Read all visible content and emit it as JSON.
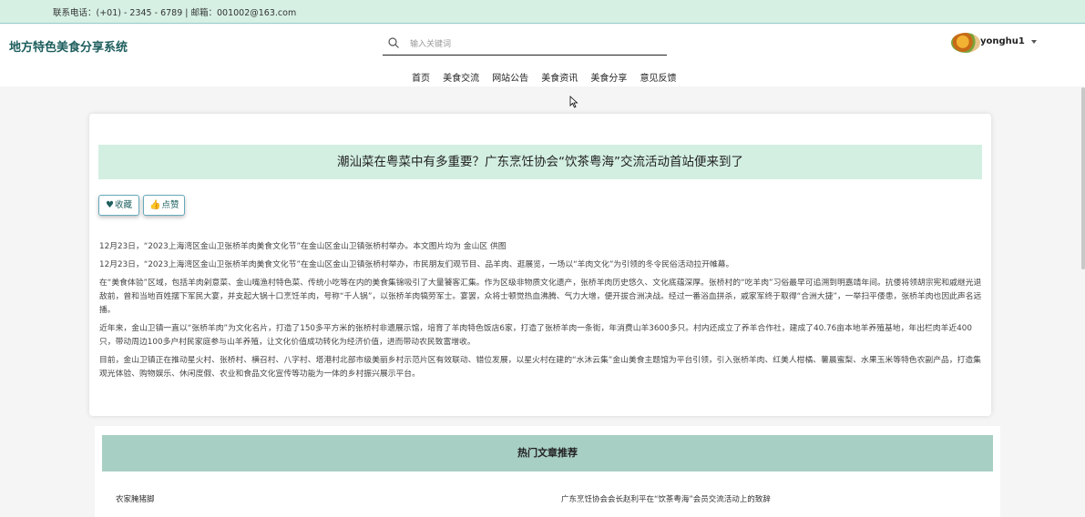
{
  "topbar": {
    "contact": "联系电话：(+01) - 2345 - 6789 | 邮箱：001002@163.com"
  },
  "header": {
    "logo": "地方特色美食分享系统",
    "search_placeholder": "输入关键词",
    "username": "yonghu1"
  },
  "nav": [
    "首页",
    "美食交流",
    "网站公告",
    "美食资讯",
    "美食分享",
    "意见反馈"
  ],
  "article": {
    "title": "潮汕菜在粤菜中有多重要？广东烹饪协会“饮茶粤海”交流活动首站便来到了",
    "favorite_label": "收藏",
    "like_label": "点赞",
    "paragraphs": [
      "12月23日，“2023上海湾区金山卫张桥羊肉美食文化节”在金山区金山卫镇张桥村举办。本文图片均为 金山区 供图",
      "12月23日，“2023上海湾区金山卫张桥羊肉美食文化节”在金山区金山卫镇张桥村举办，市民朋友们观节目、品羊肉、逛展览，一场以“羊肉文化”为引领的冬令民俗活动拉开帷幕。",
      "在“美食体验”区域，包括羊肉剁意菜、金山嘴渔村特色菜、传统小吃等在内的美食集锦吸引了大量饕客汇集。作为区级非物质文化遗产，张桥羊肉历史悠久、文化底蕴深厚。张桥村的“吃羊肉”习俗最早可追溯到明嘉靖年间。抗倭将领胡宗宪和戚继光退敌前，曾和当地百姓摆下军民大宴，并支起大锅十口烹饪羊肉，号称“千人锅”，以张桥羊肉犒劳军士。宴罢，众将士顿觉热血沸腾、气力大增，便开拔合洲决战。经过一番浴血拼杀，戚家军终于取得“合洲大捷”，一举扫平倭患，张桥羊肉也因此声名远播。",
      "近年来，金山卫镇一直以“张桥羊肉”为文化名片，打造了150多平方米的张桥村非遗展示馆，培育了羊肉特色饭店6家，打造了张桥羊肉一条街，年消费山羊3600多只。村内还成立了养羊合作社，建成了40.76亩本地羊养殖基地，年出栏肉羊近400只，带动周边100多户村民家庭参与山羊养殖，让文化价值成功转化为经济价值，进而带动农民致富增收。",
      "目前，金山卫镇正在推动星火村、张桥村、横召村、八字村、塔港村北部市级美丽乡村示范片区有效联动、错位发展，以星火村在建的“水沐云集”金山美食主题馆为平台引领，引入张桥羊肉、红美人柑橘、薯晨蜜梨、水果玉米等特色农副产品，打造集观光体验、购物娱乐、休闲度假、农业和食品文化宣传等功能为一体的乡村振兴展示平台。"
    ]
  },
  "hot": {
    "heading": "热门文章推荐",
    "items": [
      "农家腌猪脚",
      "广东烹饪协会会长赵利平在“饮茶粤海”会员交流活动上的致辞"
    ]
  },
  "colors": {
    "topbar_bg": "#d6f0e4",
    "title_bar_bg": "#d3efe2",
    "hot_head_bg": "#a8cfc4",
    "logo": "#1e5e5e"
  },
  "icons": {
    "search": "search-icon",
    "favorite": "heart-icon",
    "like": "thumbs-up-icon",
    "user_menu": "caret-down-icon"
  }
}
